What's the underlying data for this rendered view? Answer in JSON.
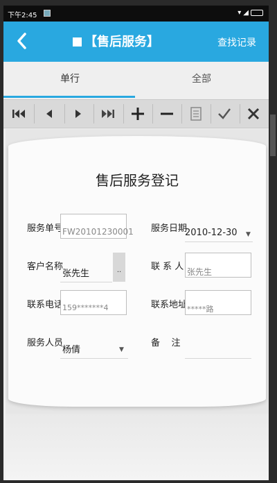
{
  "status_bar": {
    "time": "下午2:45"
  },
  "title_bar": {
    "title": "【售后服务】",
    "search_records": "查找记录"
  },
  "tabs": [
    {
      "label": "单行"
    },
    {
      "label": "全部"
    }
  ],
  "toolbar": {
    "buttons": [
      "first-icon",
      "prev-icon",
      "next-icon",
      "last-icon",
      "add-icon",
      "remove-icon",
      "save-icon",
      "confirm-icon",
      "cancel-icon"
    ]
  },
  "form": {
    "title": "售后服务登记",
    "service_no": {
      "label": "服务单号",
      "value": "FW20101230001"
    },
    "service_date": {
      "label": "服务日期",
      "value": "2010-12-30"
    },
    "customer": {
      "label": "客户名称",
      "value": "张先生",
      "button": ".."
    },
    "contact": {
      "label": "联 系 人",
      "value": "张先生"
    },
    "phone": {
      "label": "联系电话",
      "value": "159*******4"
    },
    "address": {
      "label": "联系地址",
      "value": "*****路"
    },
    "staff": {
      "label": "服务人员",
      "value": "杨倩"
    },
    "remark": {
      "label": "备    注",
      "value": ""
    }
  },
  "colors": {
    "accent": "#29a8e0"
  }
}
